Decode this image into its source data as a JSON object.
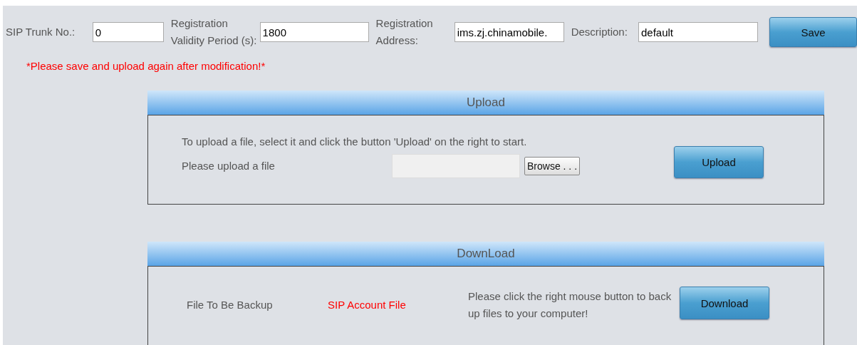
{
  "trunk_form": {
    "fields": [
      {
        "label": "SIP Trunk No.:",
        "value": "0"
      },
      {
        "label": "Registration Validity Period (s):",
        "value": "1800"
      },
      {
        "label": "Registration Address:",
        "value": "ims.zj.chinamobile."
      },
      {
        "label": "Description:",
        "value": "default"
      }
    ],
    "save_button": "Save",
    "warning": "*Please save and upload again after modification!*"
  },
  "upload": {
    "title": "Upload",
    "instruction": "To upload a file, select it and click the button 'Upload' on the right to start.",
    "file_label": "Please upload a file",
    "browse_button": "Browse . . .",
    "upload_button": "Upload"
  },
  "download": {
    "title": "DownLoad",
    "file_label": "File To Be Backup",
    "file_name": "SIP Account File",
    "hint": "Please click the right mouse button to back up files to your computer!",
    "download_button": "Download"
  }
}
